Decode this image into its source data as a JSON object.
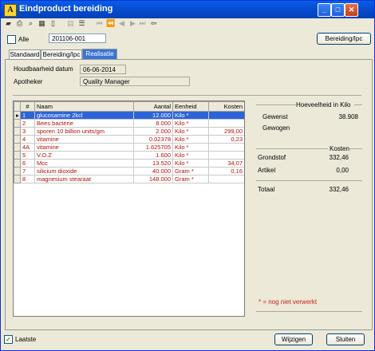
{
  "window": {
    "title": "Eindproduct bereiding"
  },
  "header": {
    "alle_label": "Alle",
    "id_value": "201106-001",
    "bereiding_button": "Bereiding/Ipc"
  },
  "tabs": [
    "Standaard",
    "Bereiding/Ipc",
    "Realisatie"
  ],
  "info": {
    "houdbaarheid_label": "Houdbaarheid datum",
    "houdbaarheid_value": "06-06-2014",
    "apotheker_label": "Apotheker",
    "apotheker_value": "Quality Manager"
  },
  "table": {
    "columns": [
      "#",
      "Naam",
      "Aantal",
      "Eenheid",
      "Kosten"
    ],
    "rows": [
      {
        "num": "1",
        "naam": "glucosamine 2kcl",
        "aantal": "12.000",
        "eenheid": "Kilo *",
        "kosten": ""
      },
      {
        "num": "2",
        "naam": "Bees bacterie",
        "aantal": "8.000",
        "eenheid": "Kilo *",
        "kosten": ""
      },
      {
        "num": "3",
        "naam": "sporen 10 billion units/gm",
        "aantal": "2.000",
        "eenheid": "Kilo *",
        "kosten": "299,00"
      },
      {
        "num": "4",
        "naam": "vitamine",
        "aantal": "0.02378",
        "eenheid": "Kilo *",
        "kosten": "0,23"
      },
      {
        "num": "4A",
        "naam": "vitamine",
        "aantal": "1.625705",
        "eenheid": "Kilo *",
        "kosten": ""
      },
      {
        "num": "5",
        "naam": "V.O.Z",
        "aantal": "1.600",
        "eenheid": "Kilo *",
        "kosten": ""
      },
      {
        "num": "6",
        "naam": "Mcc",
        "aantal": "13.520",
        "eenheid": "Kilo *",
        "kosten": "34,07"
      },
      {
        "num": "7",
        "naam": "silicium dioxide",
        "aantal": "40.000",
        "eenheid": "Gram *",
        "kosten": "0,16"
      },
      {
        "num": "8",
        "naam": "magnesium stearaat",
        "aantal": "148.000",
        "eenheid": "Gram *",
        "kosten": ""
      }
    ]
  },
  "summary": {
    "hoeveelheid_header": "Hoeveelheid in Kilo",
    "gewenst_label": "Gewenst",
    "gewenst_value": "38.908",
    "gewogen_label": "Gewogen",
    "kosten_header": "Kosten",
    "grondstof_label": "Grondstof",
    "grondstof_value": "332,46",
    "artikel_label": "Artikel",
    "artikel_value": "0,00",
    "totaal_label": "Totaal",
    "totaal_value": "332,46",
    "note": "* = nog niet verwerkt"
  },
  "footer": {
    "laatste_label": "Laatste",
    "wijzigen_button": "Wijzigen",
    "sluiten_button": "Sluiten"
  },
  "colors": {
    "titlebar": "#0548c8",
    "selection": "#2c64d8",
    "unprocessed_text": "#b0120a"
  }
}
